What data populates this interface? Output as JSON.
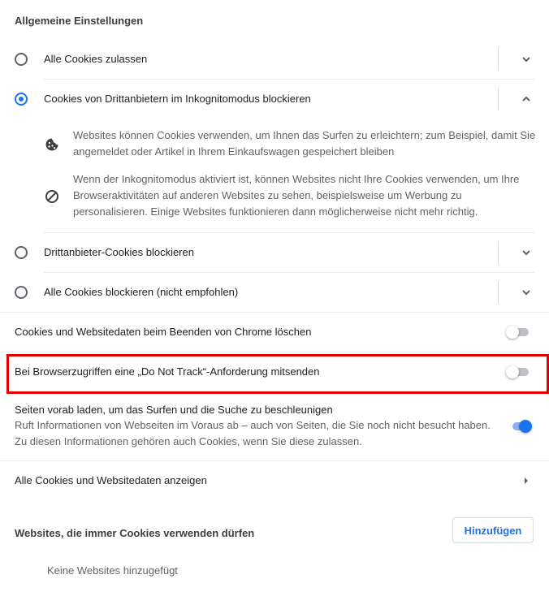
{
  "general": {
    "title": "Allgemeine Einstellungen",
    "options": [
      {
        "label": "Alle Cookies zulassen",
        "checked": false,
        "expanded": false
      },
      {
        "label": "Cookies von Drittanbietern im Inkognitomodus blockieren",
        "checked": true,
        "expanded": true
      },
      {
        "label": "Drittanbieter-Cookies blockieren",
        "checked": false,
        "expanded": false
      },
      {
        "label": "Alle Cookies blockieren (nicht empfohlen)",
        "checked": false,
        "expanded": false
      }
    ],
    "details": {
      "cookie_text_1": "Websites können Cookies verwenden, um Ihnen das Surfen zu erleichtern; zum Beispiel, damit Sie",
      "cookie_text_2": "angemeldet oder Artikel in Ihrem Einkaufswagen gespeichert bleiben",
      "block_text_1": "Wenn der Inkognitomodus aktiviert ist, können Websites nicht Ihre Cookies verwenden, um Ihre",
      "block_text_2": "Browseraktivitäten auf anderen Websites zu sehen, beispielsweise um Werbung zu",
      "block_text_3": "personalisieren. Einige Websites funktionieren dann möglicherweise nicht mehr richtig."
    }
  },
  "toggles": {
    "clear_on_exit": {
      "label": "Cookies und Websitedaten beim Beenden von Chrome löschen",
      "on": false
    },
    "do_not_track": {
      "label": "Bei Browserzugriffen eine „Do Not Track“-Anforderung mitsenden",
      "on": false
    },
    "preload": {
      "label": "Seiten vorab laden, um das Surfen und die Suche zu beschleunigen",
      "desc_1": "Ruft Informationen von Webseiten im Voraus ab – auch von Seiten, die Sie noch nicht besucht haben.",
      "desc_2": "Zu diesen Informationen gehören auch Cookies, wenn Sie diese zulassen.",
      "on": true
    }
  },
  "all_cookies_link": "Alle Cookies und Websitedaten anzeigen",
  "allowed_sites": {
    "title": "Websites, die immer Cookies verwenden dürfen",
    "add_button": "Hinzufügen",
    "empty_text": "Keine Websites hinzugefügt"
  },
  "colors": {
    "accent": "#1a73e8",
    "highlight_border": "#e00000"
  },
  "icons": {
    "cookie": "cookie-icon",
    "block": "block-icon",
    "chevron_down": "chevron-down-icon",
    "chevron_up": "chevron-up-icon",
    "arrow_right": "arrow-right-icon"
  }
}
